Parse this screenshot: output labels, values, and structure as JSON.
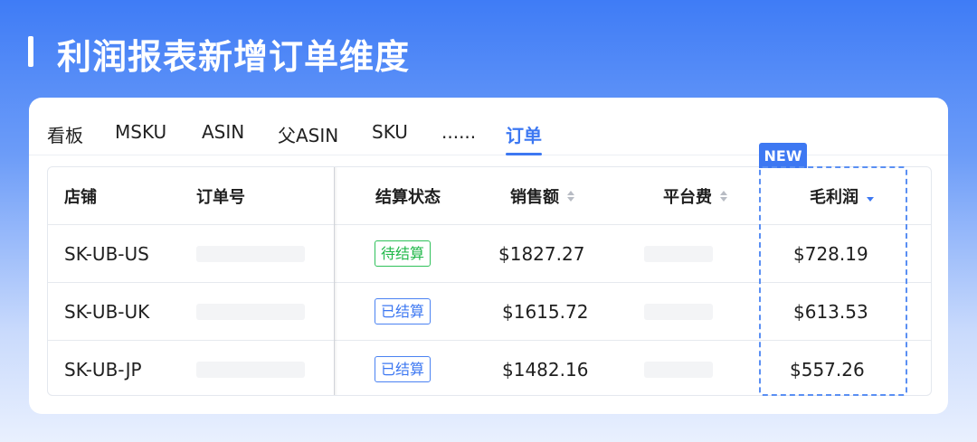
{
  "page": {
    "title": "利润报表新增订单维度"
  },
  "tabs": [
    {
      "label": "看板"
    },
    {
      "label": "MSKU"
    },
    {
      "label": "ASIN"
    },
    {
      "label": "父ASIN"
    },
    {
      "label": "SKU"
    },
    {
      "label": "......"
    },
    {
      "label": "订单",
      "active": true
    }
  ],
  "new_tag": "NEW",
  "table": {
    "headers": {
      "store": "店铺",
      "order_no": "订单号",
      "settlement_status": "结算状态",
      "sales": "销售额",
      "platform_fee": "平台费",
      "gross_profit": "毛利润"
    },
    "rows": [
      {
        "store": "SK-UB-US",
        "status": "待结算",
        "status_type": "pending",
        "sales": "$1827.27",
        "gross_profit": "$728.19"
      },
      {
        "store": "SK-UB-UK",
        "status": "已结算",
        "status_type": "done",
        "sales": "$1615.72",
        "gross_profit": "$613.53"
      },
      {
        "store": "SK-UB-JP",
        "status": "已结算",
        "status_type": "done",
        "sales": "$1482.16",
        "gross_profit": "$557.26"
      }
    ]
  },
  "colors": {
    "accent": "#3d78f2",
    "pending": "#21b84a"
  }
}
